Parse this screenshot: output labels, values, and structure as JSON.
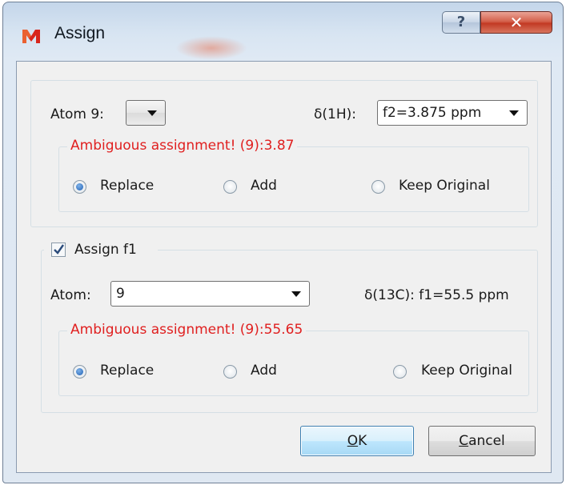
{
  "window": {
    "title": "Assign",
    "help_symbol": "?",
    "close_symbol": "✕",
    "accent": "#d4614c"
  },
  "proton": {
    "atom_label": "Atom 9:",
    "atom_value": "",
    "shift_label": "δ(1H):",
    "shift_value": "f2=3.875 ppm",
    "warning": "Ambiguous assignment! (9):3.87",
    "options": [
      "Replace",
      "Add",
      "Keep Original"
    ],
    "selected": "Replace"
  },
  "carbon": {
    "assign_label": "Assign f1",
    "assign_checked": true,
    "atom_label": "Atom:",
    "atom_value": "9",
    "shift_text": "δ(13C): f1=55.5 ppm",
    "warning": "Ambiguous assignment! (9):55.65",
    "options": [
      "Replace",
      "Add",
      "Keep Original"
    ],
    "selected": "Replace"
  },
  "buttons": {
    "ok_mnemonic": "O",
    "ok_rest": "K",
    "cancel_mnemonic": "C",
    "cancel_rest": "ancel"
  },
  "colors": {
    "warning": "#e02020",
    "radio_selected": "#1f5fb3",
    "default_button": "#3c7fb1"
  },
  "icons": [
    "app-logo-icon",
    "help-icon",
    "close-icon",
    "chevron-down-icon",
    "checkmark-icon"
  ]
}
